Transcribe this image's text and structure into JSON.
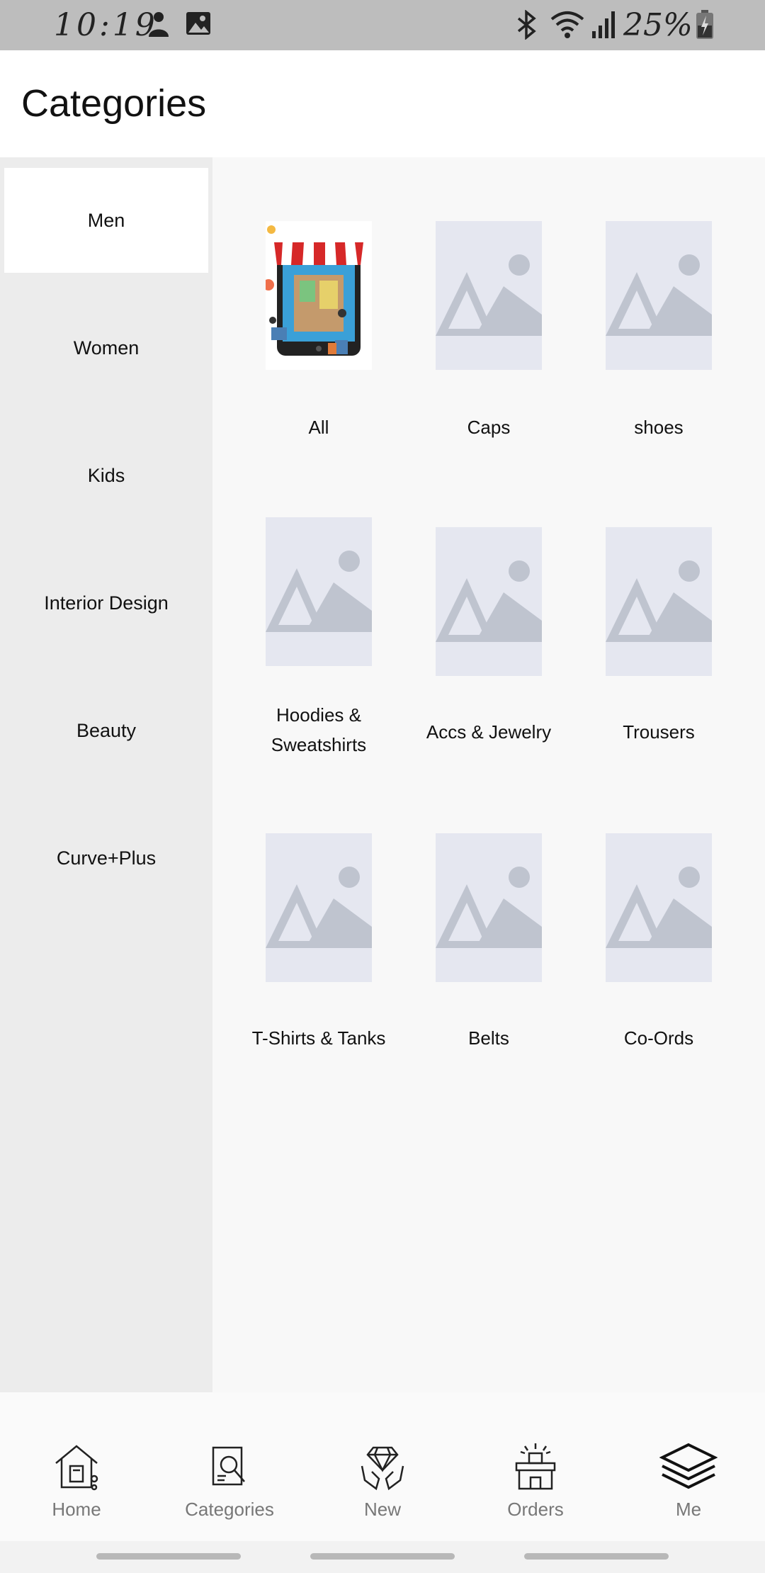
{
  "status_bar": {
    "time": "10:19",
    "battery": "25%",
    "icons": [
      "person-notification-icon",
      "image-notification-icon",
      "bluetooth-icon",
      "wifi-icon",
      "signal-icon",
      "battery-charging-icon"
    ]
  },
  "header": {
    "title": "Categories"
  },
  "sidebar": {
    "items": [
      {
        "label": "Men",
        "active": true
      },
      {
        "label": "Women",
        "active": false
      },
      {
        "label": "Kids",
        "active": false
      },
      {
        "label": "Interior Design",
        "active": false
      },
      {
        "label": "Beauty",
        "active": false
      },
      {
        "label": "Curve+Plus",
        "active": false
      }
    ]
  },
  "categories": [
    {
      "label": "All",
      "image": "shop-illustration"
    },
    {
      "label": "Caps",
      "image": "placeholder"
    },
    {
      "label": "shoes",
      "image": "placeholder"
    },
    {
      "label": "Hoodies & Sweatshirts",
      "image": "placeholder"
    },
    {
      "label": "Accs & Jewelry",
      "image": "placeholder"
    },
    {
      "label": "Trousers",
      "image": "placeholder"
    },
    {
      "label": "T-Shirts & Tanks",
      "image": "placeholder"
    },
    {
      "label": "Belts",
      "image": "placeholder"
    },
    {
      "label": "Co-Ords",
      "image": "placeholder"
    }
  ],
  "bottom_nav": {
    "items": [
      {
        "label": "Home",
        "icon": "home-icon"
      },
      {
        "label": "Categories",
        "icon": "categories-search-icon",
        "active": true
      },
      {
        "label": "New",
        "icon": "diamond-hands-icon"
      },
      {
        "label": "Orders",
        "icon": "orders-box-icon"
      },
      {
        "label": "Me",
        "icon": "layers-icon"
      }
    ]
  },
  "colors": {
    "status_bar": "#bdbdbd",
    "sidebar_bg": "#ececec",
    "placeholder_bg": "#e5e7f0",
    "placeholder_art": "#bfc4cf",
    "nav_label": "#777777"
  }
}
